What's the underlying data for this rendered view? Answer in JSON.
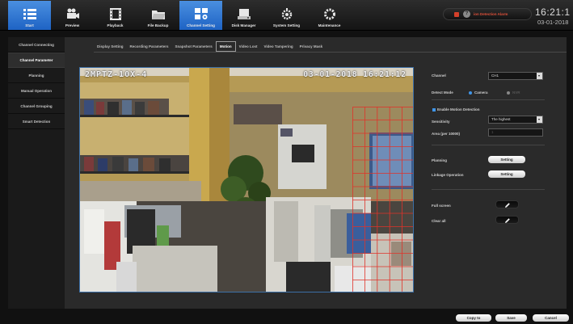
{
  "topnav": {
    "items": [
      {
        "label": "Start",
        "icon": "start-menu-icon",
        "active": true
      },
      {
        "label": "Preview",
        "icon": "preview-icon",
        "active": false
      },
      {
        "label": "Playback",
        "icon": "playback-icon",
        "active": false
      },
      {
        "label": "File Backup",
        "icon": "folder-icon",
        "active": false
      },
      {
        "label": "Channel Setting",
        "icon": "channel-setting-icon",
        "active": true
      },
      {
        "label": "Disk Manager",
        "icon": "disk-icon",
        "active": false
      },
      {
        "label": "System Setting",
        "icon": "system-gear-icon",
        "active": false
      },
      {
        "label": "Maintenance",
        "icon": "maintenance-gear-icon",
        "active": false
      }
    ]
  },
  "alarm": {
    "text": "ion Detection Alarm",
    "indicator_color": "#d4402a",
    "icon": "help-icon"
  },
  "clock": {
    "time": "16:21:1",
    "date": "03-01-2018"
  },
  "sidebar": {
    "items": [
      {
        "label": "Channel Connecting",
        "active": false
      },
      {
        "label": "Channel Parameter",
        "active": true
      },
      {
        "label": "Planning",
        "active": false
      },
      {
        "label": "Manual Operation",
        "active": false
      },
      {
        "label": "Channel Grouping",
        "active": false
      },
      {
        "label": "Smart Detection",
        "active": false
      }
    ]
  },
  "tabs": [
    {
      "label": "Display Setting",
      "active": false
    },
    {
      "label": "Recording Parameters",
      "active": false
    },
    {
      "label": "Snapshot Parameters",
      "active": false
    },
    {
      "label": "Motion",
      "active": true
    },
    {
      "label": "Video Lost",
      "active": false
    },
    {
      "label": "Video Tampering",
      "active": false
    },
    {
      "label": "Privacy Mask",
      "active": false
    }
  ],
  "video": {
    "camera_name": "2MPTZ-10X-4",
    "timestamp": "03-01-2018 16:21:12"
  },
  "settings": {
    "channel_label": "Channel",
    "channel_value": "CH1",
    "detect_mode_label": "Detect Mode",
    "detect_mode_options": [
      "Camera",
      "NVR"
    ],
    "enable_motion_label": "Enable Motion Detection",
    "sensitivity_label": "Sensitivity",
    "sensitivity_value": "The highest",
    "area_label": "Area (per 10000)",
    "area_value": "1",
    "planning_label": "Planning",
    "planning_button": "Setting",
    "linkage_label": "Linkage Operation",
    "linkage_button": "Setting",
    "fullscreen_label": "Full screen",
    "clear_all_label": "Clear all"
  },
  "bottom": {
    "copy_to": "Copy to",
    "save": "Save",
    "cancel": "Cancel"
  },
  "colors": {
    "accent_blue": "#2f7ad8",
    "motion_grid": "#e0332a"
  }
}
